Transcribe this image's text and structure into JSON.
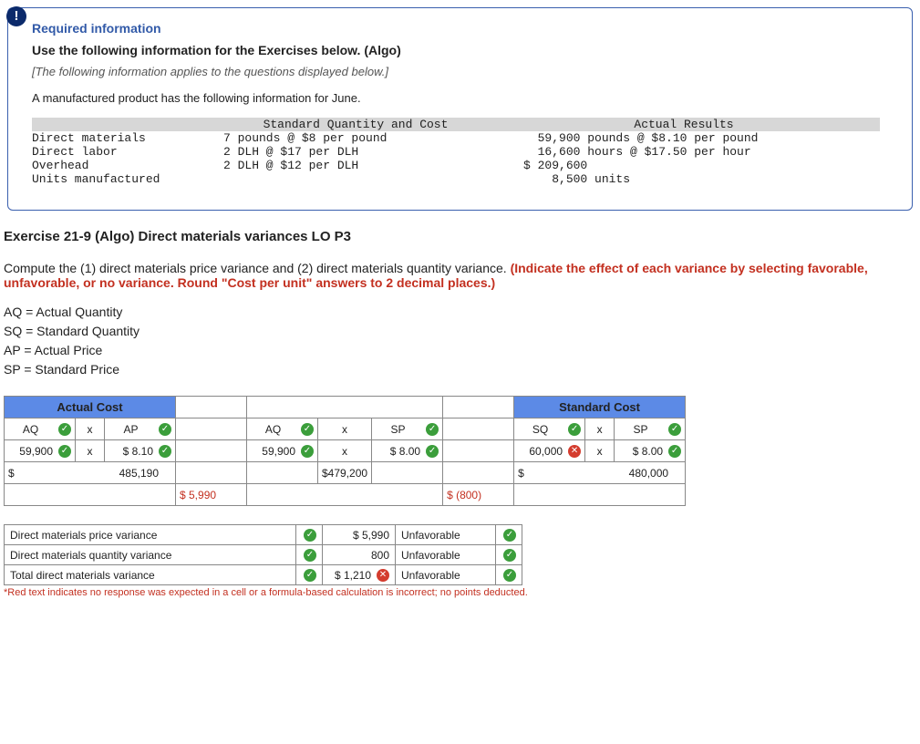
{
  "info": {
    "required_title": "Required information",
    "bold_line": "Use the following information for the Exercises below. (Algo)",
    "italic_line": "[The following information applies to the questions displayed below.]",
    "intro": "A manufactured product has the following information for June.",
    "headers": {
      "std": "Standard Quantity and Cost",
      "act": "Actual Results"
    },
    "rows": {
      "dm": {
        "label": "Direct materials",
        "std": "7 pounds @ $8 per pound",
        "act": "59,900 pounds @ $8.10 per pound"
      },
      "dl": {
        "label": "Direct labor",
        "std": "2 DLH @ $17 per DLH",
        "act": "16,600 hours @ $17.50 per hour"
      },
      "oh": {
        "label": "Overhead",
        "std": "2 DLH @ $12 per DLH",
        "act": "$ 209,600"
      },
      "um": {
        "label": "Units manufactured",
        "std": "",
        "act": "    8,500 units"
      }
    }
  },
  "exercise": {
    "title": "Exercise 21-9 (Algo) Direct materials variances LO P3",
    "prompt_plain": "Compute the (1) direct materials price variance and (2) direct materials quantity variance. ",
    "prompt_red": "(Indicate the effect of each variance by selecting favorable, unfavorable, or no variance. Round \"Cost per unit\" answers to 2 decimal places.)",
    "legend": {
      "aq": "AQ = Actual Quantity",
      "sq": "SQ = Standard Quantity",
      "ap": "AP = Actual Price",
      "sp": "SP = Standard Price"
    }
  },
  "grid": {
    "hdr_actual": "Actual Cost",
    "hdr_standard": "Standard Cost",
    "col1": {
      "aq_label": "AQ",
      "x": "x",
      "ap_label": "AP",
      "aq_val": "59,900",
      "ap_val": "$  8.10",
      "total_prefix": "$",
      "total": "485,190"
    },
    "col2": {
      "aq_label": "AQ",
      "x": "x",
      "sp_label": "SP",
      "aq_val": "59,900",
      "sp_val": "$  8.00",
      "total": "$479,200"
    },
    "col3": {
      "sq_label": "SQ",
      "x": "x",
      "sp_label": "SP",
      "sq_val": "60,000",
      "sp_val": "$  8.00",
      "total_prefix": "$",
      "total": "480,000"
    },
    "diff1": "$ 5,990",
    "diff2": "$  (800)"
  },
  "summary": {
    "r1": {
      "label": "Direct materials price variance",
      "value": "$ 5,990",
      "effect": "Unfavorable",
      "val_ok": true
    },
    "r2": {
      "label": "Direct materials quantity variance",
      "value": "800",
      "effect": "Unfavorable",
      "val_ok": true
    },
    "r3": {
      "label": "Total direct materials variance",
      "value": "$ 1,210",
      "effect": "Unfavorable",
      "val_ok": false
    }
  },
  "footnote": "*Red text indicates no response was expected in a cell or a formula-based calculation is incorrect; no points deducted."
}
